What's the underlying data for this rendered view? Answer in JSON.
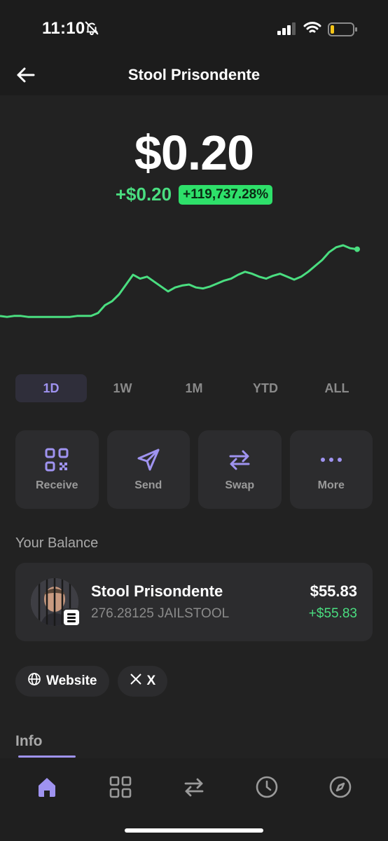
{
  "status": {
    "time": "11:10"
  },
  "header": {
    "title": "Stool Prisondente"
  },
  "price": {
    "value": "$0.20",
    "change": "+$0.20",
    "change_percent": "+119,737.28%"
  },
  "chart_data": {
    "type": "line",
    "color": "#4ade80",
    "range": "1D",
    "y": [
      0.28,
      0.27,
      0.28,
      0.28,
      0.27,
      0.27,
      0.27,
      0.27,
      0.27,
      0.27,
      0.27,
      0.28,
      0.28,
      0.28,
      0.31,
      0.39,
      0.43,
      0.5,
      0.6,
      0.7,
      0.66,
      0.68,
      0.63,
      0.58,
      0.53,
      0.57,
      0.59,
      0.6,
      0.57,
      0.56,
      0.58,
      0.61,
      0.64,
      0.66,
      0.7,
      0.73,
      0.71,
      0.68,
      0.66,
      0.69,
      0.71,
      0.68,
      0.65,
      0.68,
      0.73,
      0.79,
      0.85,
      0.93,
      0.98,
      1.0,
      0.97,
      0.96
    ]
  },
  "ranges": [
    {
      "label": "1D",
      "active": true
    },
    {
      "label": "1W",
      "active": false
    },
    {
      "label": "1M",
      "active": false
    },
    {
      "label": "YTD",
      "active": false
    },
    {
      "label": "ALL",
      "active": false
    }
  ],
  "actions": {
    "receive": "Receive",
    "send": "Send",
    "swap": "Swap",
    "more": "More",
    "icon_color": "#9f93f0"
  },
  "balance": {
    "section_title": "Your Balance",
    "token_name": "Stool Prisondente",
    "amount": "276.28125 JAILSTOOL",
    "value": "$55.83",
    "change": "+$55.83"
  },
  "links": {
    "website": "Website",
    "x": "X"
  },
  "info": {
    "title": "Info"
  },
  "colors": {
    "accent": "#9f93f0",
    "positive": "#4ade80",
    "background": "#222222",
    "card": "#2c2c2e"
  },
  "tabbar": {
    "icons": [
      "home-icon",
      "grid-icon",
      "swap-icon",
      "clock-icon",
      "compass-icon"
    ]
  }
}
